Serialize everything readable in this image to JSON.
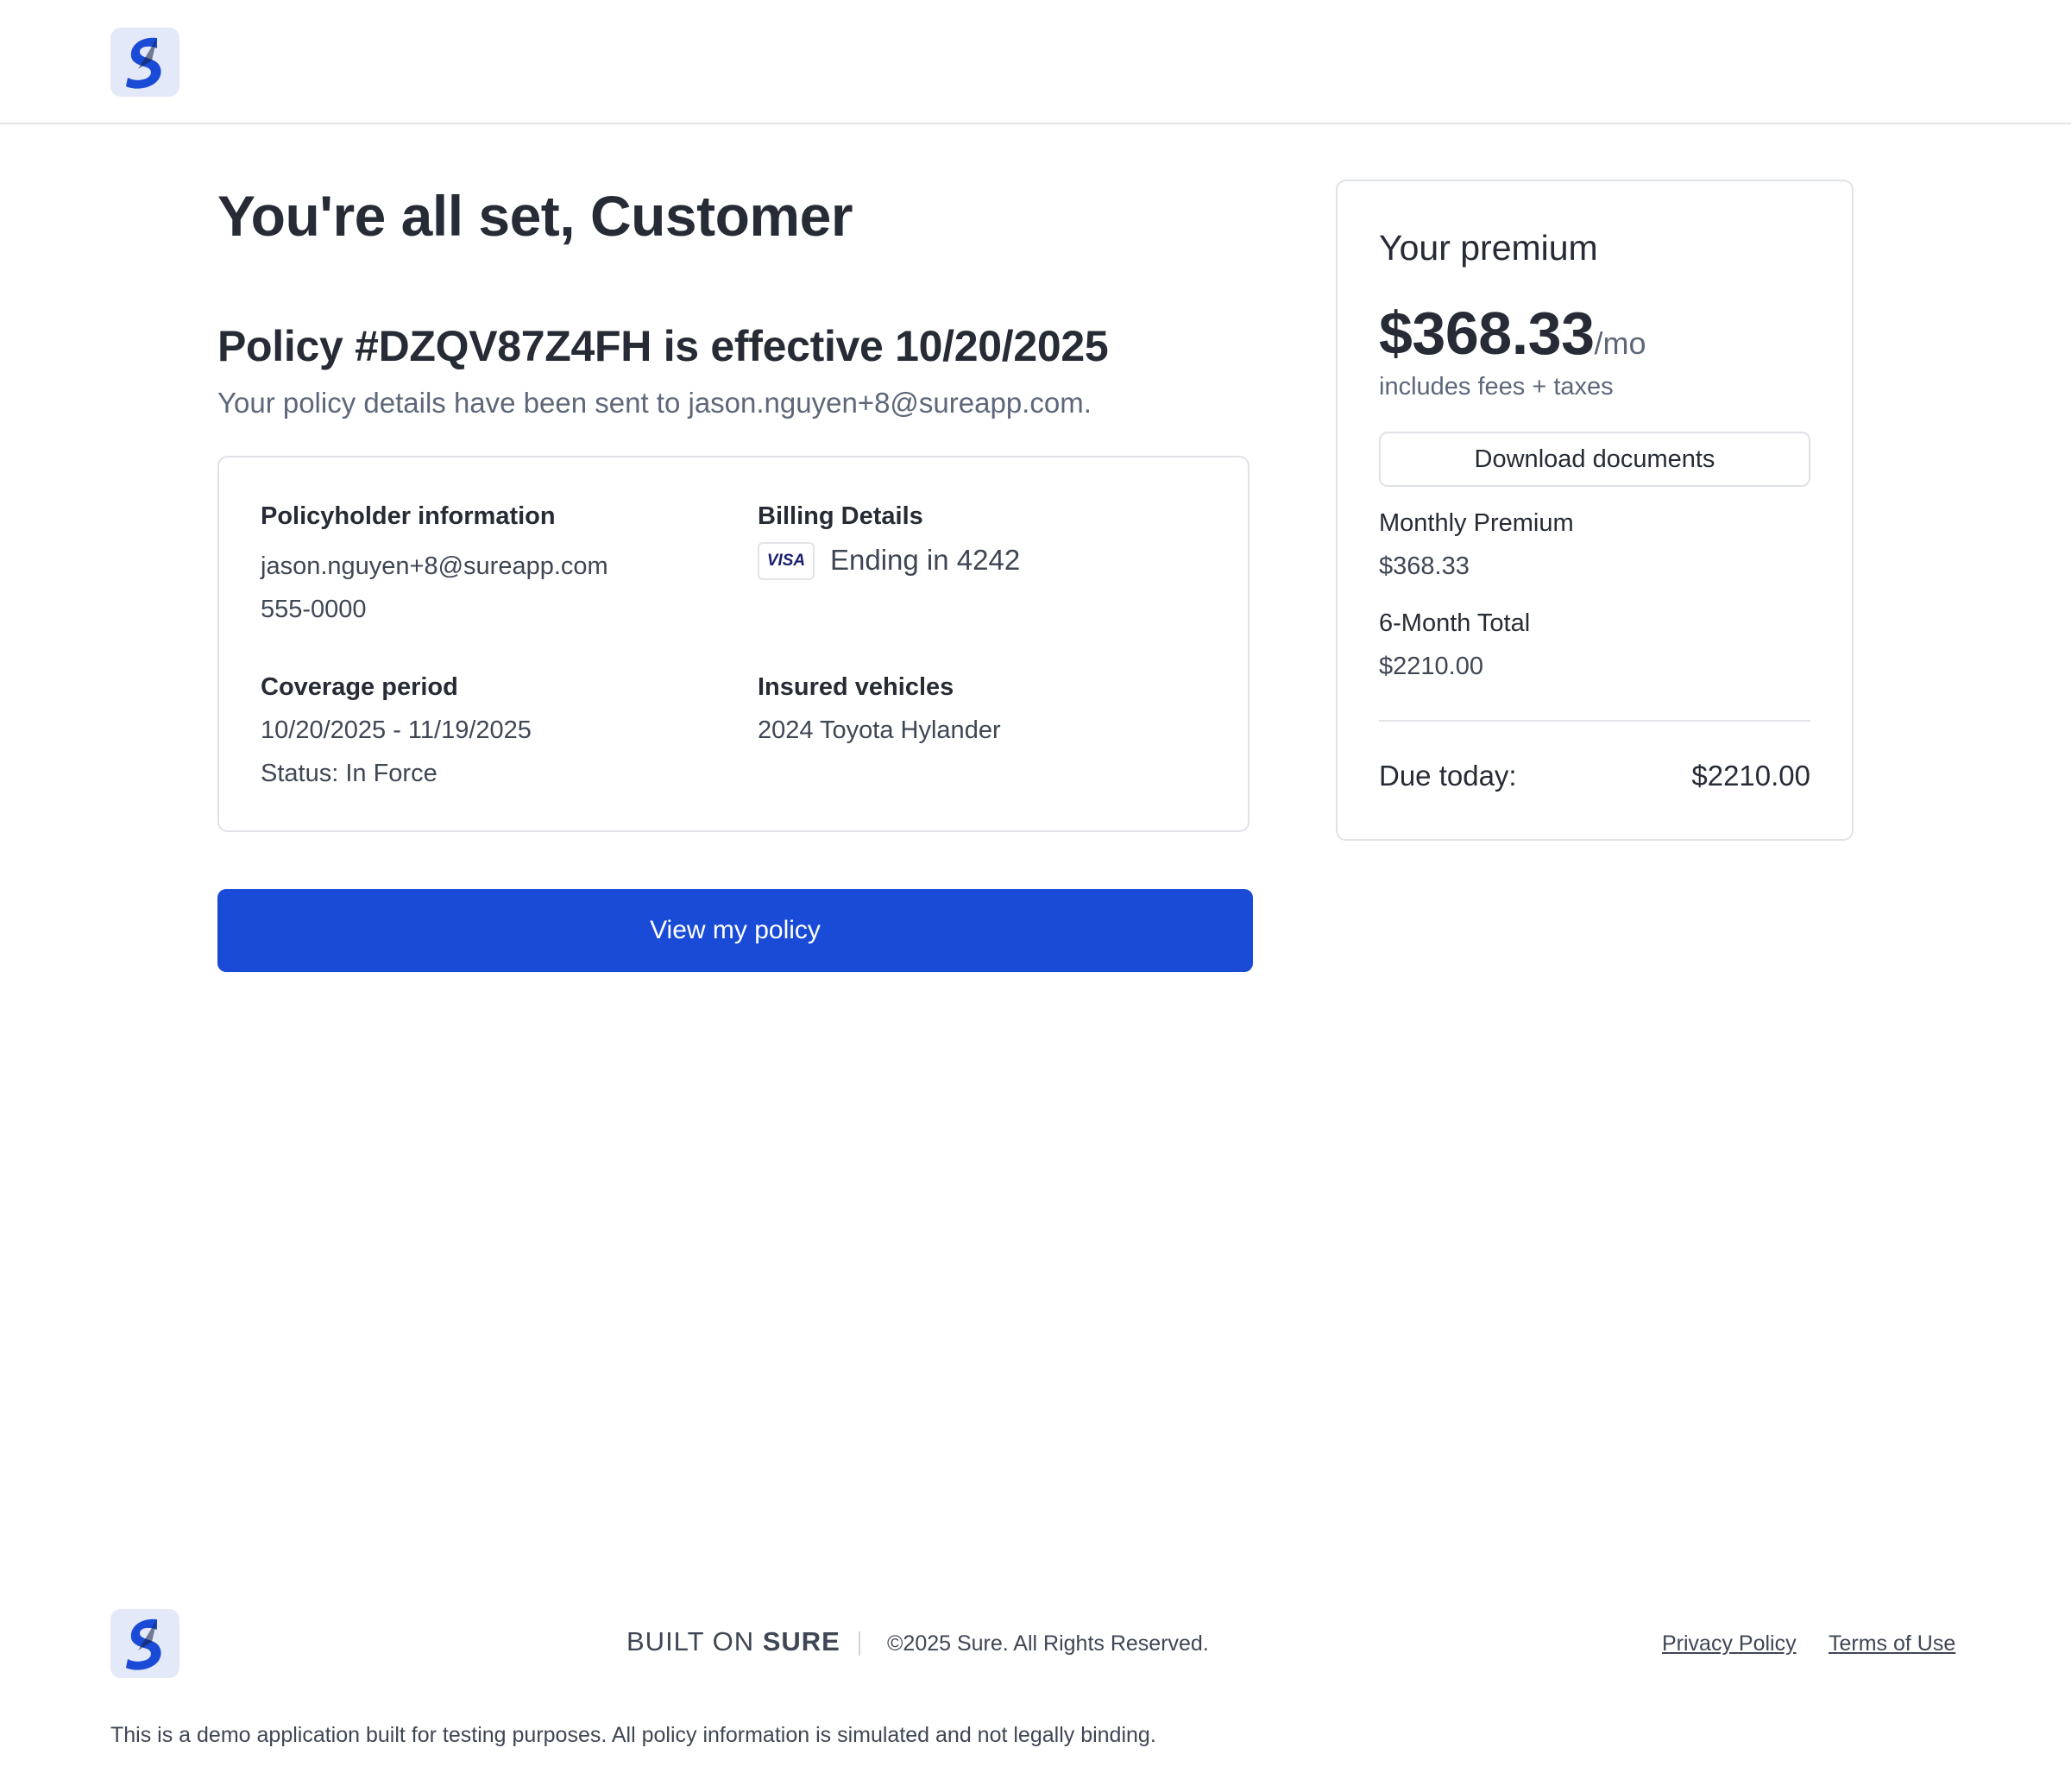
{
  "brand": {
    "logo_icon": "sure-logo-icon",
    "accent_color": "#1a4bd6"
  },
  "main": {
    "title": "You're all set, Customer",
    "policy_heading": "Policy #DZQV87Z4FH is effective 10/20/2025",
    "policy_subtext": "Your policy details have been sent to jason.nguyen+8@sureapp.com."
  },
  "details": {
    "policyholder": {
      "label": "Policyholder information",
      "email": "jason.nguyen+8@sureapp.com",
      "phone": "555-0000"
    },
    "billing": {
      "label": "Billing Details",
      "card_brand": "VISA",
      "card_ending": "Ending in 4242"
    },
    "coverage": {
      "label": "Coverage period",
      "period": "10/20/2025 - 11/19/2025",
      "status": "Status: In Force"
    },
    "vehicles": {
      "label": "Insured vehicles",
      "items": [
        "2024 Toyota Hylander"
      ]
    }
  },
  "actions": {
    "view_policy": "View my policy"
  },
  "premium": {
    "title": "Your premium",
    "amount": "$368.33",
    "unit": "/mo",
    "note": "includes fees + taxes",
    "download_label": "Download documents",
    "monthly_label": "Monthly Premium",
    "monthly_value": "$368.33",
    "six_month_label": "6-Month Total",
    "six_month_value": "$2210.00",
    "due_label": "Due today:",
    "due_value": "$2210.00"
  },
  "footer": {
    "built_on_text": "BUILT ON",
    "built_on_brand": "SURE",
    "copyright": "©2025 Sure. All Rights Reserved.",
    "privacy": "Privacy Policy",
    "terms": "Terms of Use",
    "disclaimer": "This is a demo application built for testing purposes. All policy information is simulated and not legally binding."
  }
}
